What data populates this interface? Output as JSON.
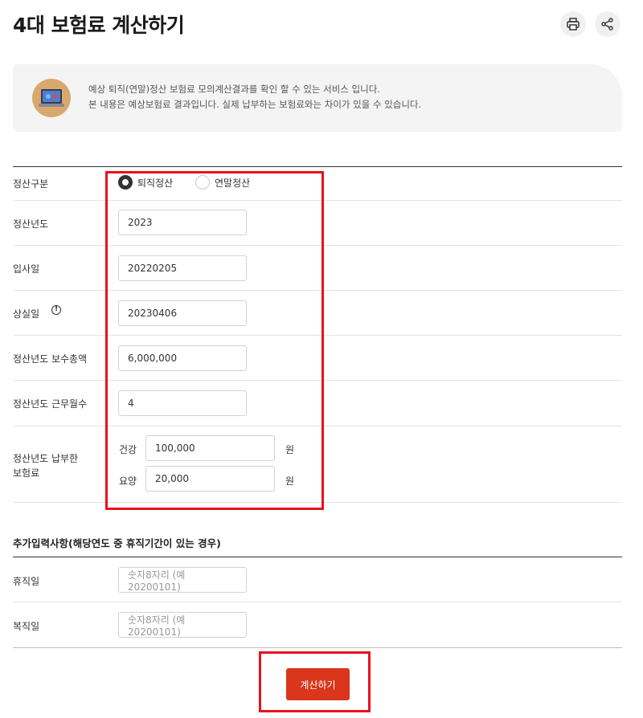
{
  "header": {
    "title": "4대 보험료 계산하기",
    "print_icon": "print-icon",
    "share_icon": "share-icon"
  },
  "notice": {
    "icon": "laptop-icon",
    "line1": "예상 퇴직(연말)정산 보험료 모의계산결과를 확인 할 수 있는 서비스 입니다.",
    "line2": "본 내용은 예상보험료 결과입니다. 실제 납부하는 보험료와는 차이가 있을 수 있습니다."
  },
  "form": {
    "settlement_type": {
      "label": "정산구분",
      "options": [
        {
          "label": "퇴직정산",
          "selected": true
        },
        {
          "label": "연말정산",
          "selected": false
        }
      ]
    },
    "year": {
      "label": "정산년도",
      "value": "2023"
    },
    "join_date": {
      "label": "입사일",
      "value": "20220205"
    },
    "loss_date": {
      "label": "상실일",
      "info_icon": "info-icon",
      "value": "20230406"
    },
    "total_pay": {
      "label": "정산년도 보수총액",
      "value": "6,000,000"
    },
    "months": {
      "label": "정산년도 근무월수",
      "value": "4"
    },
    "paid": {
      "label_line1": "정산년도 납부한",
      "label_line2": "보험료",
      "health": {
        "label": "건강",
        "value": "100,000",
        "unit": "원"
      },
      "care": {
        "label": "요양",
        "value": "20,000",
        "unit": "원"
      }
    }
  },
  "additional": {
    "title": "추가입력사항(해당연도 중 휴직기간이 있는 경우)",
    "leave": {
      "label": "휴직일",
      "placeholder": "숫자8자리 (예 20200101)"
    },
    "return": {
      "label": "복직일",
      "placeholder": "숫자8자리 (예 20200101)"
    }
  },
  "actions": {
    "calculate": "계산하기"
  },
  "colors": {
    "accent": "#d9361c",
    "highlight": "#e8111e"
  }
}
